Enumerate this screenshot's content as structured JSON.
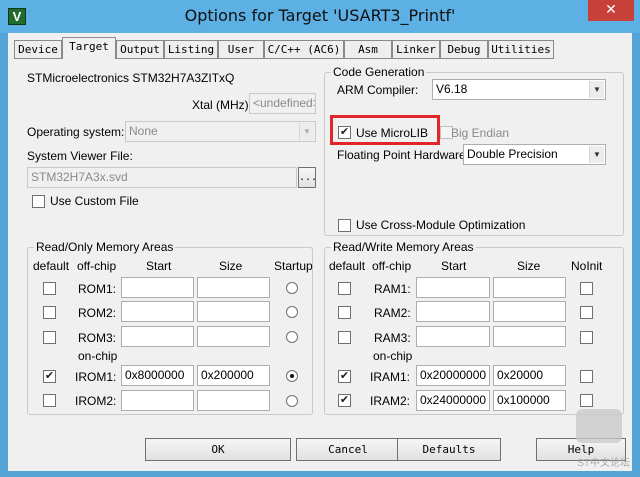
{
  "window": {
    "title": "Options for Target 'USART3_Printf'",
    "close_glyph": "✕",
    "icon_letter": "V"
  },
  "tabs": [
    "Device",
    "Target",
    "Output",
    "Listing",
    "User",
    "C/C++ (AC6)",
    "Asm",
    "Linker",
    "Debug",
    "Utilities"
  ],
  "active_tab": "Target",
  "device": {
    "name": "STMicroelectronics STM32H7A3ZITxQ",
    "xtal_label": "Xtal (MHz):",
    "xtal_value": "<undefined>",
    "os_label": "Operating system:",
    "os_value": "None",
    "svd_label": "System Viewer File:",
    "svd_value": "STM32H7A3x.svd",
    "browse_label": "...",
    "custom_file_label": "Use Custom File",
    "custom_file_checked": false
  },
  "codegen": {
    "title": "Code Generation",
    "compiler_label": "ARM Compiler:",
    "compiler_value": "V6.18",
    "microlib_label": "Use MicroLIB",
    "microlib_checked": true,
    "big_endian_label": "Big Endian",
    "big_endian_checked": false,
    "fpu_label": "Floating Point Hardware:",
    "fpu_value": "Double Precision",
    "cross_module_label": "Use Cross-Module Optimization",
    "cross_module_checked": false
  },
  "ro_memory": {
    "title": "Read/Only Memory Areas",
    "headers": {
      "default": "default",
      "offchip": "off-chip",
      "start": "Start",
      "size": "Size",
      "startup": "Startup"
    },
    "onchip_label": "on-chip",
    "rows": [
      {
        "name": "ROM1:",
        "default": false,
        "start": "",
        "size": "",
        "startup": false
      },
      {
        "name": "ROM2:",
        "default": false,
        "start": "",
        "size": "",
        "startup": false
      },
      {
        "name": "ROM3:",
        "default": false,
        "start": "",
        "size": "",
        "startup": false
      },
      {
        "name": "IROM1:",
        "default": true,
        "start": "0x8000000",
        "size": "0x200000",
        "startup": true
      },
      {
        "name": "IROM2:",
        "default": false,
        "start": "",
        "size": "",
        "startup": false
      }
    ]
  },
  "rw_memory": {
    "title": "Read/Write Memory Areas",
    "headers": {
      "default": "default",
      "offchip": "off-chip",
      "start": "Start",
      "size": "Size",
      "noinit": "NoInit"
    },
    "onchip_label": "on-chip",
    "rows": [
      {
        "name": "RAM1:",
        "default": false,
        "start": "",
        "size": "",
        "noinit": false
      },
      {
        "name": "RAM2:",
        "default": false,
        "start": "",
        "size": "",
        "noinit": false
      },
      {
        "name": "RAM3:",
        "default": false,
        "start": "",
        "size": "",
        "noinit": false
      },
      {
        "name": "IRAM1:",
        "default": true,
        "start": "0x20000000",
        "size": "0x20000",
        "noinit": false
      },
      {
        "name": "IRAM2:",
        "default": true,
        "start": "0x24000000",
        "size": "0x100000",
        "noinit": false
      }
    ]
  },
  "buttons": {
    "ok": "OK",
    "cancel": "Cancel",
    "defaults": "Defaults",
    "help": "Help"
  },
  "watermark": {
    "text": "ST中文论坛"
  },
  "colors": {
    "highlight": "#e0262b",
    "titlebar": "#5cb0e3",
    "close": "#c7403a"
  }
}
